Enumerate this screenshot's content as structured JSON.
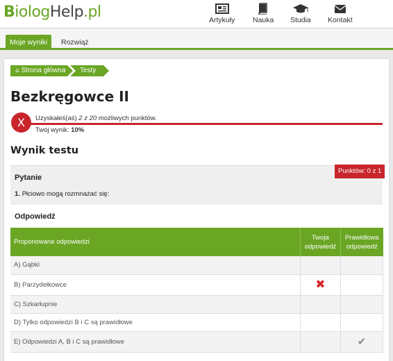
{
  "site": {
    "logo_b": "B",
    "logo_rest": "iolog",
    "logo_help": "Help",
    "logo_pl": ".pl"
  },
  "nav": [
    {
      "label": "Artykuły",
      "icon": "newspaper-icon"
    },
    {
      "label": "Nauka",
      "icon": "book-icon"
    },
    {
      "label": "Studia",
      "icon": "graduation-cap-icon"
    },
    {
      "label": "Kontakt",
      "icon": "envelope-icon"
    }
  ],
  "tabs": {
    "active": "Moje wyniki",
    "other": "Rozwiąż"
  },
  "breadcrumb": {
    "home": "Strona główna",
    "tests": "Testy"
  },
  "page": {
    "title": "Bezkręgowce II"
  },
  "result": {
    "fail_mark": "X",
    "line_prefix": "Uzyskałeś(aś) ",
    "scored": "2 z 20",
    "line_suffix": " możliwych punktów.",
    "score_label": "Twój wynik: ",
    "score_value": "10%",
    "colors": {
      "fail": "#c8262c",
      "accent": "#6aa624"
    }
  },
  "section_title": "Wynik testu",
  "question": {
    "label": "Pytanie",
    "number": "1.",
    "text": " Płciowo mogą rozmnażać się:",
    "points_badge": "Punktów: 0 z 1"
  },
  "answer_label": "Odpowiedź",
  "table": {
    "headers": {
      "answers": "Proponowane odpowiedzi",
      "yours_1": "Twoja",
      "yours_2": "odpowiedź",
      "correct_1": "Prawidłowa",
      "correct_2": "odpowiedź"
    },
    "rows": [
      {
        "text": "A) Gąbki",
        "yours": "",
        "correct": ""
      },
      {
        "text": "B) Parzydełkowce",
        "yours": "✖",
        "correct": ""
      },
      {
        "text": "C) Szkarłupnie",
        "yours": "",
        "correct": ""
      },
      {
        "text": "D) Tylko odpowiedzi B i C są prawidłowe",
        "yours": "",
        "correct": ""
      },
      {
        "text": "E) Odpowiedzi A, B i C są prawidłowe",
        "yours": "",
        "correct": "✔"
      }
    ]
  }
}
